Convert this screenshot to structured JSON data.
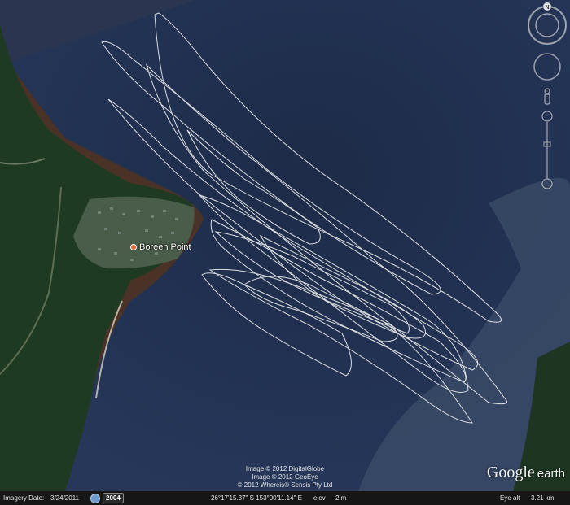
{
  "map": {
    "place_label": "Boreen Point",
    "copyright_lines": [
      "Image © 2012 DigitalGlobe",
      "Image © 2012 GeoEye",
      "© 2012 Whereis® Sensis Pty Ltd"
    ],
    "logo_primary": "Google",
    "logo_secondary": "earth",
    "compass_north": "N",
    "colors": {
      "water_deep": "#22304f",
      "water_shallow": "#3c4f6a",
      "shore_sediment": "#5a3a2a",
      "forest": "#1f3a22",
      "track": "#e8e8e8"
    }
  },
  "statusbar": {
    "imagery_date_label": "Imagery Date:",
    "imagery_date_value": "3/24/2011",
    "year": "2004",
    "coordinates": "26°17'15.37\" S 153°00'11.14\" E",
    "elev_label": "elev",
    "elev_value": "2 m",
    "eye_alt_label": "Eye alt",
    "eye_alt_value": "3.21 km"
  }
}
